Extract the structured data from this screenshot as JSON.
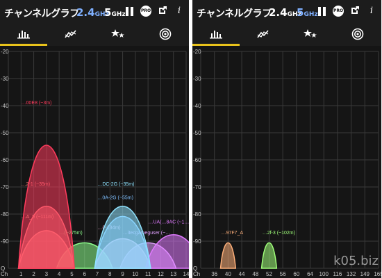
{
  "left": {
    "header": {
      "title": "チャンネルグラフ",
      "band24": "2.4",
      "band24_unit": "GHz",
      "band5": "5",
      "band5_unit": "GHz"
    },
    "icons": [
      "pause-icon",
      "pro-badge-icon",
      "share-icon",
      "info-icon"
    ],
    "pro_label": "PRO",
    "info_label": "i",
    "tabs": [
      "channel-graph-icon",
      "time-graph-icon",
      "channel-rating-icon",
      "ap-list-icon"
    ],
    "selected_tab": 0,
    "y_ticks": [
      "-20",
      "-30",
      "-40",
      "-50",
      "-60",
      "-70",
      "-80",
      "-90",
      "Q"
    ],
    "x_ticks": [
      "Ch",
      "1",
      "2",
      "3",
      "4",
      "5",
      "6",
      "7",
      "8",
      "9",
      "10",
      "11",
      "12",
      "13",
      "14"
    ],
    "networks": [
      {
        "label": "…00E8 (~3m)",
        "color": "#ff3b5c",
        "channel": 3,
        "level": -40
      },
      {
        "label": "…2-1 (~35m)",
        "color": "#ff7a7a",
        "channel": 3,
        "level": -70
      },
      {
        "label": "…A_9 (~111m)",
        "color": "#ff9e8a",
        "channel": 3,
        "level": -82
      },
      {
        "label": "…DC-2G (~35m)",
        "color": "#8fe3ff",
        "channel": 9,
        "level": -70
      },
      {
        "label": "…0A-2G (~55m)",
        "color": "#7fc0ff",
        "channel": 9,
        "level": -75
      },
      {
        "label": "…UA(…8AC (~1…",
        "color": "#e07aff",
        "channel": 13,
        "level": -84
      },
      {
        "label": "…(~194m)",
        "color": "#ffb0e0",
        "channel": 9,
        "level": -86
      },
      {
        "label": "…itecgameguser (~…",
        "color": "#e0a0ff",
        "channel": 11,
        "level": -88
      },
      {
        "label": "…(~275m)",
        "color": "#8dff8d",
        "channel": 6,
        "level": -88
      }
    ]
  },
  "right": {
    "header": {
      "title": "チャンネルグラフ",
      "band24": "2.4",
      "band24_unit": "GHz",
      "band5": "5",
      "band5_unit": "GHz"
    },
    "y_ticks": [
      "-20",
      "-30",
      "-40",
      "-50",
      "-60",
      "-70",
      "-80",
      "-90",
      "Q"
    ],
    "x_ticks": [
      "Ch",
      "36",
      "40",
      "44",
      "48",
      "52",
      "56",
      "60",
      "64",
      "100",
      "116",
      "132",
      "149",
      "165"
    ],
    "networks": [
      {
        "label": "…97F7_A",
        "color": "#ffb07a",
        "channel": 40,
        "level": -88
      },
      {
        "label": "…2f-3 (~102m)",
        "color": "#a0ff7a",
        "channel": 52,
        "level": -88
      }
    ]
  },
  "watermark": "k05.biz"
}
